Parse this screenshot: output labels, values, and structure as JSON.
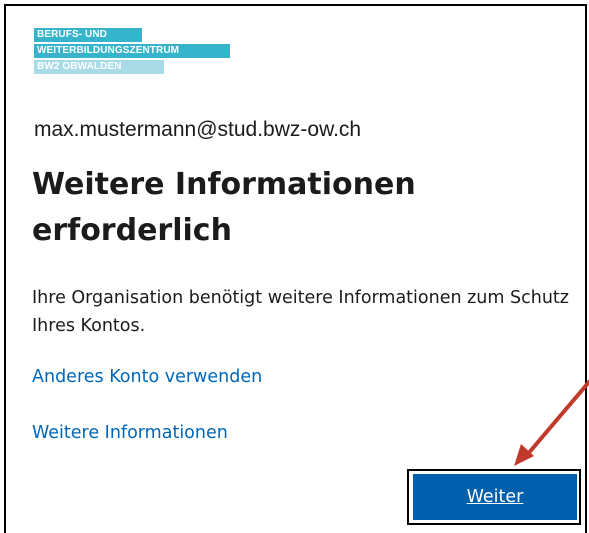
{
  "logo": {
    "line1": "BERUFS- UND",
    "line2": "WEITERBILDUNGSZENTRUM",
    "line3": "BW2 OBWALDEN",
    "color_primary": "#35b4cc",
    "color_secondary": "#a9dbe7"
  },
  "account": {
    "email": "max.mustermann@stud.bwz-ow.ch"
  },
  "heading": {
    "title": "Weitere Informationen erforderlich"
  },
  "body": {
    "description": "Ihre Organisation benötigt weitere Informationen zum Schutz Ihres Kontos."
  },
  "links": {
    "use_other_account": "Anderes Konto verwenden",
    "more_information": "Weitere Informationen",
    "color": "#0067b8"
  },
  "actions": {
    "next_label": "Weiter",
    "button_color": "#0060ad"
  },
  "annotation": {
    "arrow_icon": "arrow-icon",
    "arrow_color": "#c0392b"
  }
}
